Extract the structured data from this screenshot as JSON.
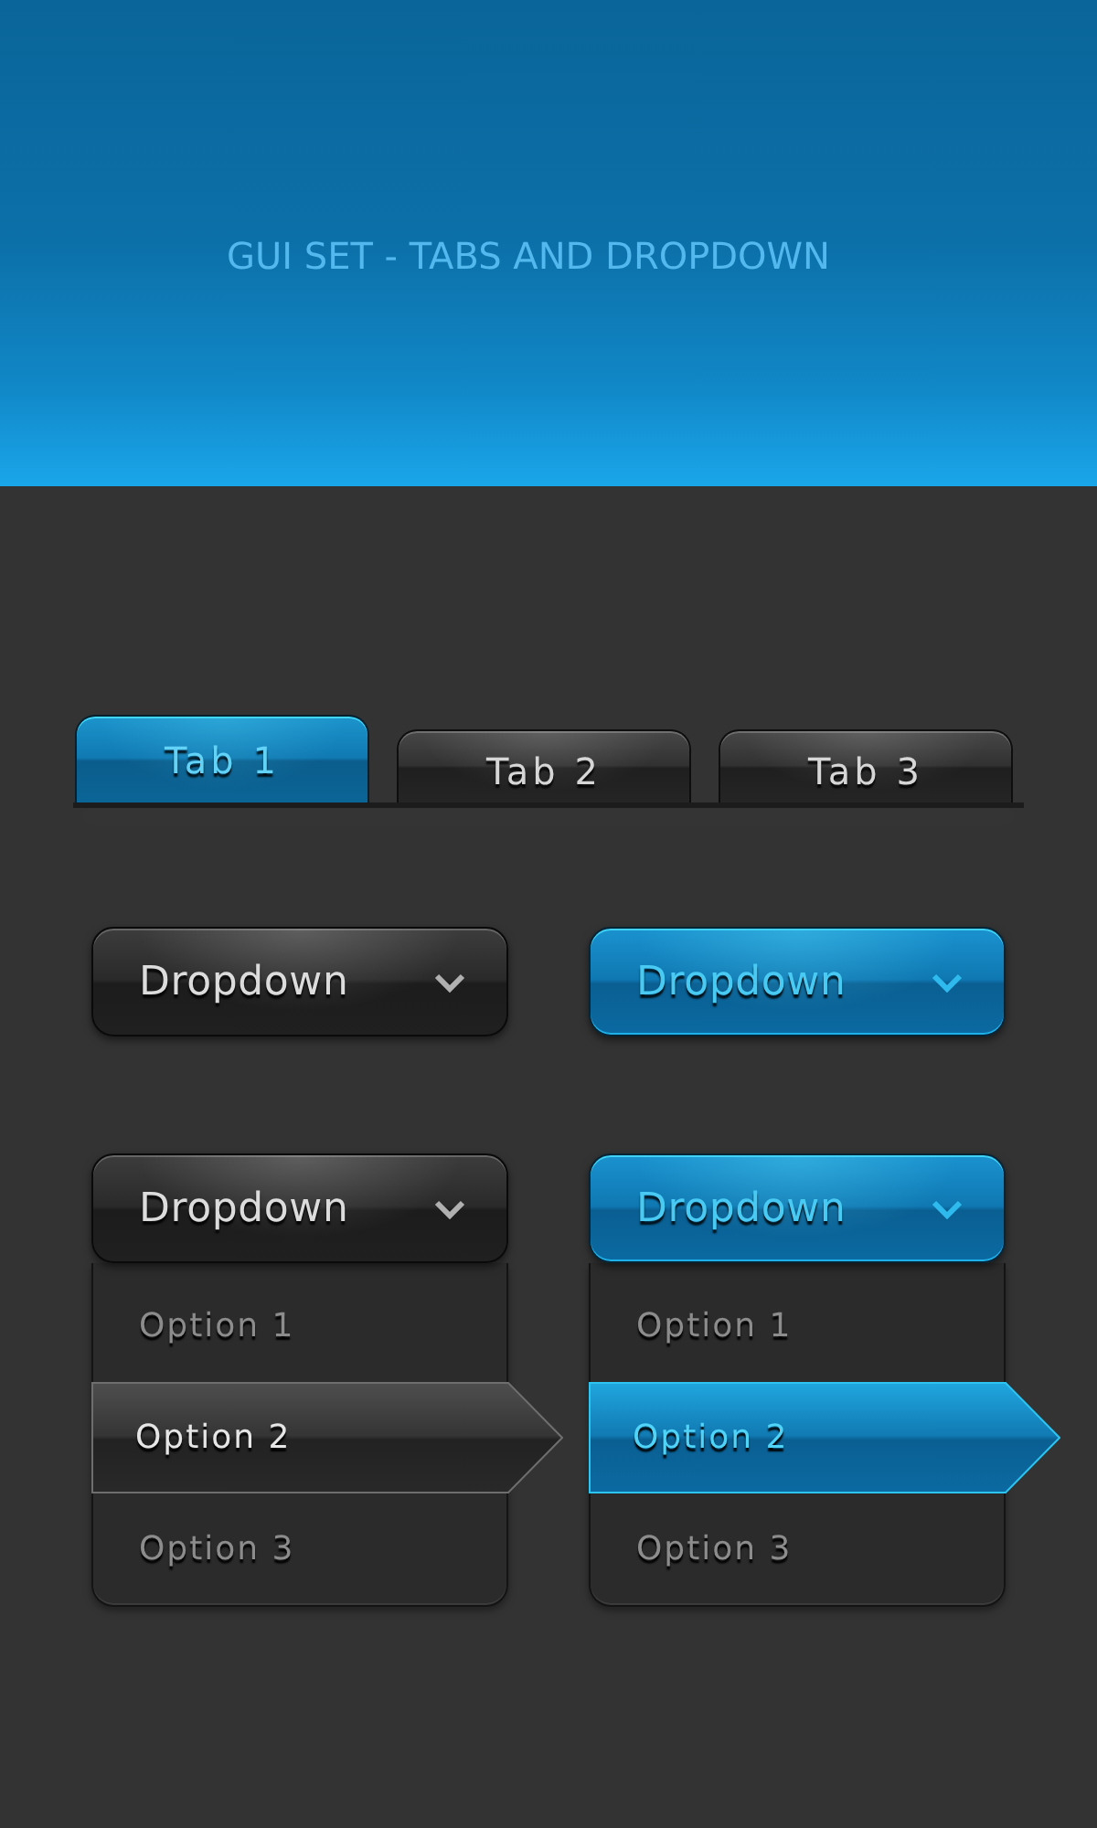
{
  "header": {
    "title": "GUI SET - TABS AND DROPDOWN"
  },
  "tabs": [
    {
      "label": "Tab 1",
      "selected": true
    },
    {
      "label": "Tab 2",
      "selected": false
    },
    {
      "label": "Tab 3",
      "selected": false
    }
  ],
  "dropdowns": [
    {
      "kind": "dark",
      "label": "Dropdown",
      "expanded": false
    },
    {
      "kind": "accent",
      "label": "Dropdown",
      "expanded": false
    },
    {
      "kind": "dark",
      "label": "Dropdown",
      "expanded": true,
      "options": [
        {
          "label": "Option 1",
          "selected": false
        },
        {
          "label": "Option 2",
          "selected": true
        },
        {
          "label": "Option 3",
          "selected": false
        }
      ]
    },
    {
      "kind": "accent",
      "label": "Dropdown",
      "expanded": true,
      "options": [
        {
          "label": "Option 1",
          "selected": false
        },
        {
          "label": "Option 2",
          "selected": true
        },
        {
          "label": "Option 3",
          "selected": false
        }
      ]
    }
  ]
}
